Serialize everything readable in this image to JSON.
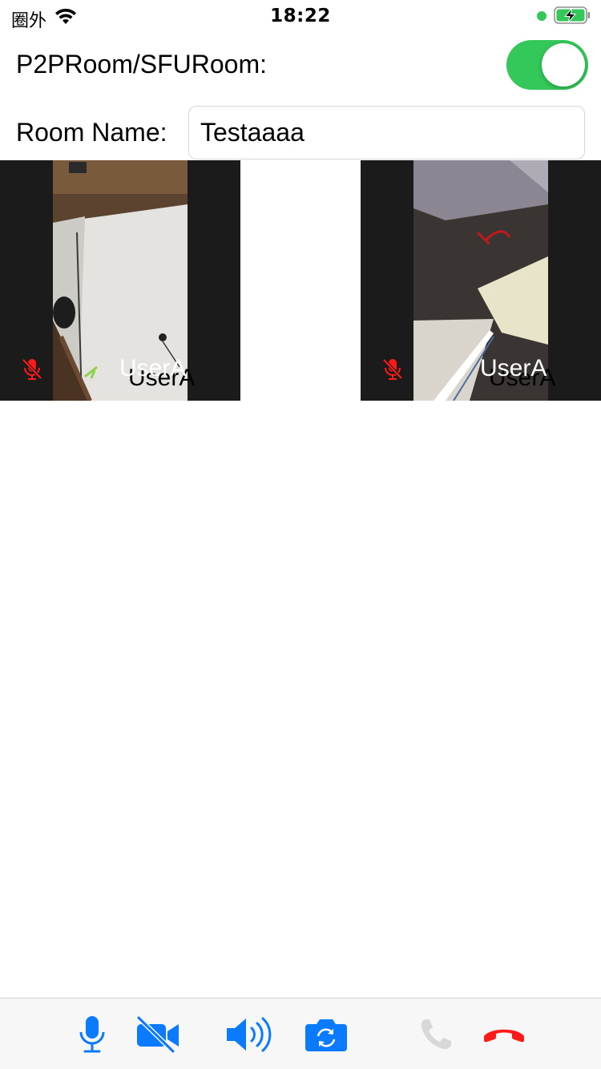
{
  "status_bar": {
    "carrier": "圈外",
    "time": "18:22"
  },
  "room_type": {
    "label": "P2PRoom/SFURoom:",
    "toggle_on": true
  },
  "room_name": {
    "label": "Room Name:",
    "value": "Testaaaa"
  },
  "tiles": [
    {
      "user_name": "UserA",
      "user_name_shadow": "UserA",
      "audio_muted": true
    },
    {
      "user_name": "UserA",
      "user_name_shadow": "UserA",
      "audio_muted": true
    }
  ],
  "toolbar": {
    "buttons": [
      {
        "icon": "microphone-icon",
        "state": "on"
      },
      {
        "icon": "video-off-icon",
        "state": "off"
      },
      {
        "icon": "speaker-icon",
        "state": "on"
      },
      {
        "icon": "camera-switch-icon",
        "state": "on"
      },
      {
        "icon": "call-icon",
        "state": "disabled"
      },
      {
        "icon": "end-call-icon",
        "state": "on"
      }
    ]
  },
  "colors": {
    "accent": "#0a7aff",
    "toggle_on": "#34c759",
    "mute": "#ff1a1a",
    "end_call": "#ff1a1a",
    "disabled": "#d0d0d0",
    "tile_background": "#1b1b1b"
  }
}
